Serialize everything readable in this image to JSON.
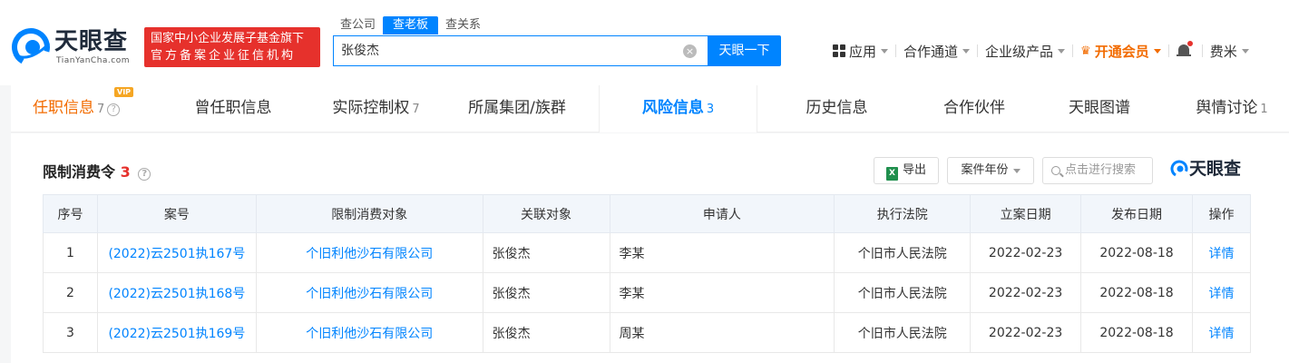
{
  "header": {
    "logo_cn": "天眼查",
    "logo_en": "TianYanCha.com",
    "slogan_line1": "国家中小企业发展子基金旗下",
    "slogan_line2": "官方备案企业征信机构",
    "search_tabs": [
      "查公司",
      "查老板",
      "查关系"
    ],
    "search_value": "张俊杰",
    "search_button": "天眼一下",
    "nav": {
      "app": "应用",
      "partner": "合作通道",
      "enterprise": "企业级产品",
      "vip": "开通会员",
      "user": "费米"
    },
    "accent_color": "#0084ff",
    "brand_red": "#e6312c"
  },
  "tabs": [
    {
      "label": "任职信息",
      "count": "7",
      "vip_tag": "VIP"
    },
    {
      "label": "曾任职信息",
      "count": ""
    },
    {
      "label": "实际控制权",
      "count": "7"
    },
    {
      "label": "所属集团/族群",
      "count": ""
    },
    {
      "label": "风险信息",
      "count": "3"
    },
    {
      "label": "历史信息",
      "count": ""
    },
    {
      "label": "合作伙伴",
      "count": ""
    },
    {
      "label": "天眼图谱",
      "count": ""
    },
    {
      "label": "舆情讨论",
      "count": "1"
    }
  ],
  "panel": {
    "title": "限制消费令",
    "count": "3",
    "export_label": "导出",
    "year_filter_label": "案件年份",
    "search_placeholder": "点击进行搜索",
    "brand": "天眼查",
    "columns": [
      "序号",
      "案号",
      "限制消费对象",
      "关联对象",
      "申请人",
      "执行法院",
      "立案日期",
      "发布日期",
      "操作"
    ],
    "rows": [
      {
        "no": "1",
        "case_no": "(2022)云2501执167号",
        "target": "个旧利他沙石有限公司",
        "related": "张俊杰",
        "applicant": "李某",
        "court": "个旧市人民法院",
        "filed": "2022-02-23",
        "published": "2022-08-18",
        "action": "详情"
      },
      {
        "no": "2",
        "case_no": "(2022)云2501执168号",
        "target": "个旧利他沙石有限公司",
        "related": "张俊杰",
        "applicant": "李某",
        "court": "个旧市人民法院",
        "filed": "2022-02-23",
        "published": "2022-08-18",
        "action": "详情"
      },
      {
        "no": "3",
        "case_no": "(2022)云2501执169号",
        "target": "个旧利他沙石有限公司",
        "related": "张俊杰",
        "applicant": "周某",
        "court": "个旧市人民法院",
        "filed": "2022-02-23",
        "published": "2022-08-18",
        "action": "详情"
      }
    ]
  }
}
